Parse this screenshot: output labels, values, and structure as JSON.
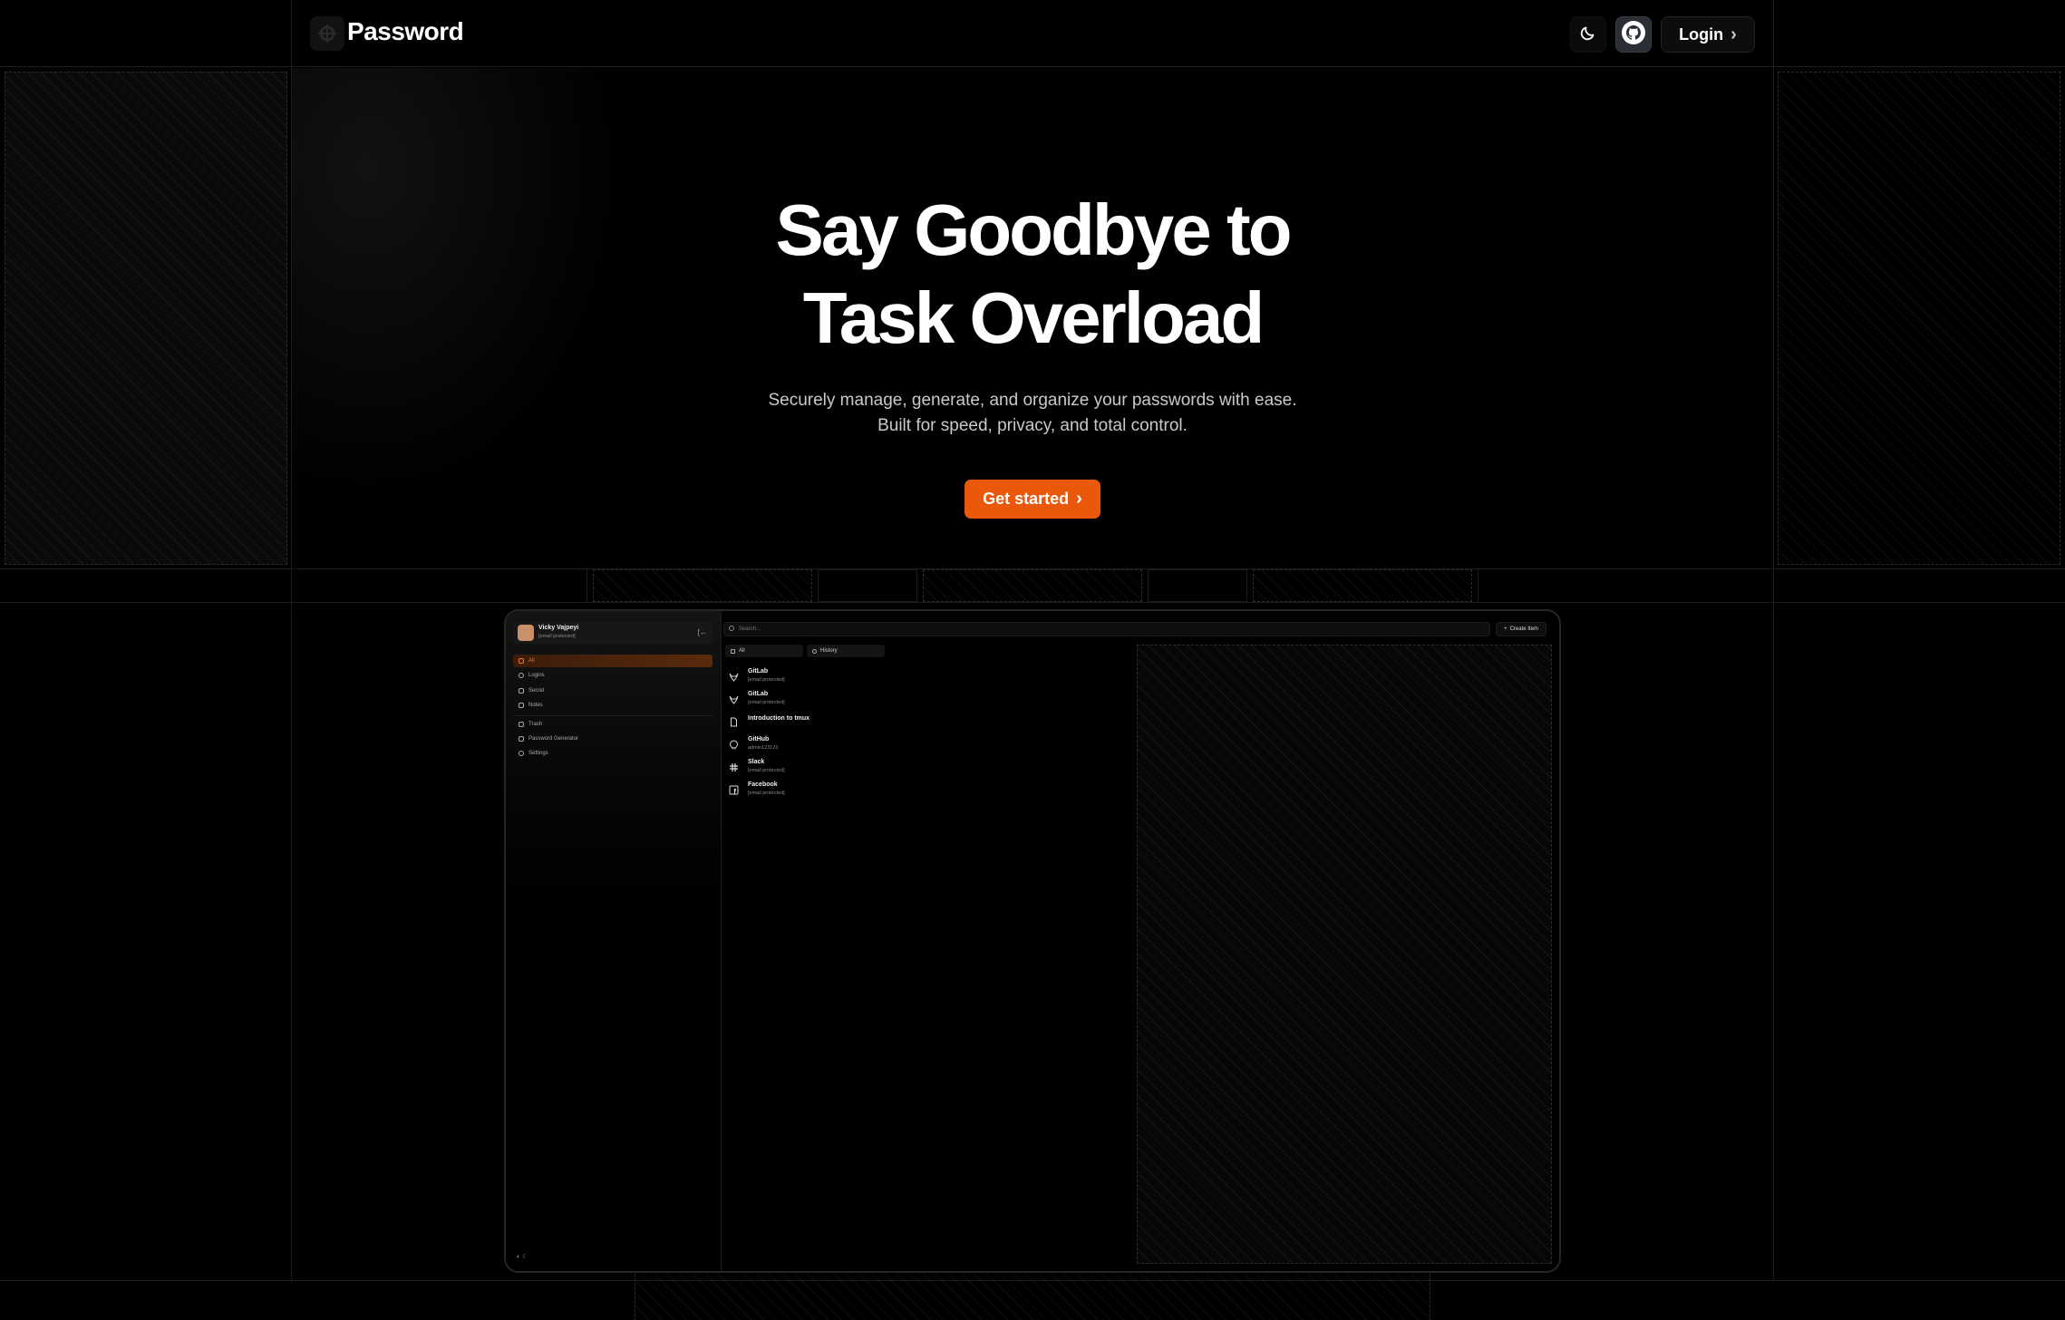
{
  "header": {
    "brand": "Password",
    "theme_toggle_icon": "moon-icon",
    "github_icon": "github-icon",
    "login_label": "Login",
    "login_chevron": "›"
  },
  "hero": {
    "title_line1": "Say Goodbye to",
    "title_line2": "Task Overload",
    "subtitle_line1": "Securely manage, generate, and organize your passwords with ease.",
    "subtitle_line2": "Built for speed, privacy, and total control.",
    "cta_label": "Get started",
    "cta_chevron": "›"
  },
  "colors": {
    "accent": "#ea580c",
    "background": "#000000",
    "border": "#1c1c1c"
  },
  "preview": {
    "user": {
      "name": "Vicky Vajpeyi",
      "email": "[email protected]"
    },
    "nav": [
      {
        "label": "All",
        "icon": "grid-icon",
        "active": true
      },
      {
        "label": "Logins",
        "icon": "user-icon",
        "active": false
      },
      {
        "label": "Secret",
        "icon": "key-icon",
        "active": false
      },
      {
        "label": "Notes",
        "icon": "note-icon",
        "active": false
      }
    ],
    "nav2": [
      {
        "label": "Trash",
        "icon": "trash-icon"
      },
      {
        "label": "Password Generator",
        "icon": "wand-icon"
      },
      {
        "label": "Settings",
        "icon": "gear-icon"
      }
    ],
    "search_placeholder": "Search...",
    "create_label": "Create Item",
    "tabs": [
      {
        "label": "All",
        "icon": "list-icon"
      },
      {
        "label": "History",
        "icon": "clock-icon"
      }
    ],
    "items": [
      {
        "title": "GitLab",
        "subtitle": "[email protected]",
        "icon": "gitlab-icon"
      },
      {
        "title": "GitLab",
        "subtitle": "[email protected]",
        "icon": "gitlab-icon"
      },
      {
        "title": "Introduction to tmux",
        "subtitle": "",
        "icon": "document-icon"
      },
      {
        "title": "GitHub",
        "subtitle": "admin123123",
        "icon": "github-icon"
      },
      {
        "title": "Slack",
        "subtitle": "[email protected]",
        "icon": "slack-icon"
      },
      {
        "title": "Facebook",
        "subtitle": "[email protected]",
        "icon": "facebook-icon"
      }
    ]
  }
}
